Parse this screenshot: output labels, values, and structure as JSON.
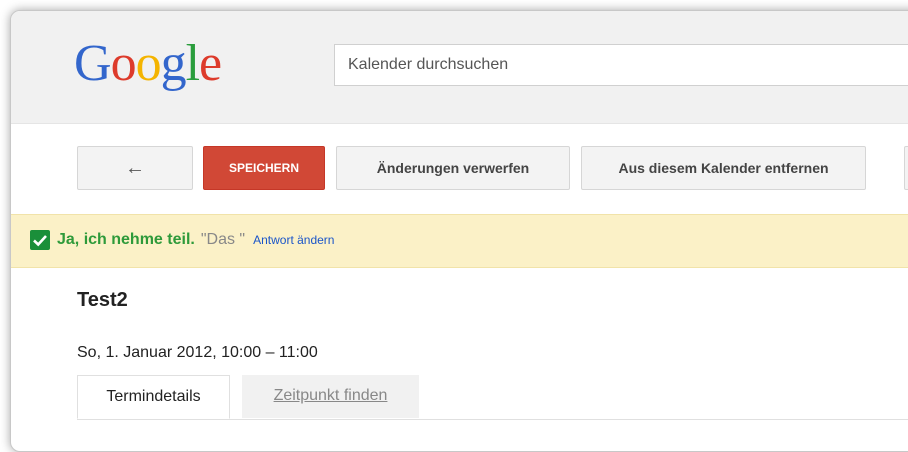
{
  "logo": {
    "letters": [
      "G",
      "o",
      "o",
      "g",
      "l",
      "e"
    ],
    "colors": [
      "#3366cc",
      "#dd3b2b",
      "#f4b400",
      "#3366cc",
      "#2a9d3c",
      "#dd3b2b"
    ]
  },
  "search": {
    "placeholder": "Kalender durchsuchen"
  },
  "toolbar": {
    "back_icon": "←",
    "save_label": "SPEICHERN",
    "discard_label": "Änderungen verwerfen",
    "remove_label": "Aus diesem Kalender entfernen"
  },
  "rsvp": {
    "status": "Ja, ich nehme teil.",
    "quote": "\"Das \"",
    "change_label": "Antwort ändern"
  },
  "event": {
    "title": "Test2",
    "datetime": "So, 1. Januar 2012, 10:00 – 11:00"
  },
  "tabs": [
    {
      "label": "Termindetails"
    },
    {
      "label": "Zeitpunkt finden"
    }
  ],
  "colors": {
    "save_button": "#d14836",
    "banner": "#fbf1c7",
    "accepted_text": "#2e9a3a",
    "link": "#1a55c9"
  }
}
